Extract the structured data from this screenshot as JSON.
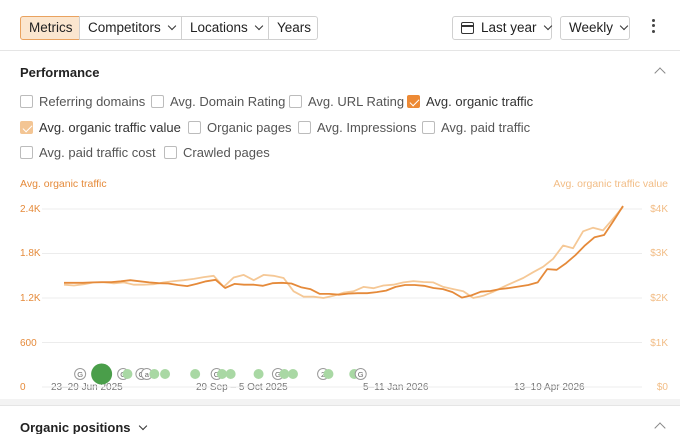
{
  "toolbar": {
    "tabs": [
      {
        "label": "Metrics",
        "active": true,
        "has_dropdown": false
      },
      {
        "label": "Competitors",
        "has_dropdown": true
      },
      {
        "label": "Locations",
        "has_dropdown": true
      },
      {
        "label": "Years",
        "has_dropdown": false
      }
    ],
    "date_range": "Last year",
    "interval": "Weekly"
  },
  "performance": {
    "title": "Performance",
    "metrics": [
      {
        "label": "Referring domains",
        "checked": false
      },
      {
        "label": "Avg. Domain Rating",
        "checked": false
      },
      {
        "label": "Avg. URL Rating",
        "checked": false
      },
      {
        "label": "Avg. organic traffic",
        "checked": true
      },
      {
        "label": "Avg. organic traffic value",
        "checked": true
      },
      {
        "label": "Organic pages",
        "checked": false
      },
      {
        "label": "Avg. Impressions",
        "checked": false
      },
      {
        "label": "Avg. paid traffic",
        "checked": false
      },
      {
        "label": "Avg. paid traffic cost",
        "checked": false
      },
      {
        "label": "Crawled pages",
        "checked": false
      }
    ]
  },
  "chart_data": {
    "type": "line",
    "left_axis_label": "Avg. organic traffic",
    "right_axis_label": "Avg. organic traffic value",
    "y_ticks_left": [
      "2.4K",
      "1.8K",
      "1.2K",
      "600",
      "0"
    ],
    "y_ticks_right": [
      "$4K",
      "$3K",
      "$2K",
      "$1K",
      "$0"
    ],
    "x_ticks": [
      "23–29 Jun 2025",
      "29 Sep – 5 Oct 2025",
      "5–11 Jan 2026",
      "13–19 Apr 2026"
    ],
    "colors": {
      "traffic": "#e58a3a",
      "value": "#f5c896",
      "marker": "#a9d8a4",
      "marker_big": "#4a9e4a"
    },
    "series": [
      {
        "name": "Avg. organic traffic",
        "axis": "left",
        "values": [
          1405,
          1405,
          1405,
          1410,
          1415,
          1415,
          1425,
          1440,
          1425,
          1410,
          1400,
          1395,
          1375,
          1360,
          1390,
          1425,
          1445,
          1335,
          1390,
          1380,
          1380,
          1365,
          1400,
          1405,
          1395,
          1345,
          1320,
          1255,
          1255,
          1245,
          1260,
          1265,
          1265,
          1280,
          1300,
          1350,
          1375,
          1375,
          1365,
          1335,
          1320,
          1280,
          1205,
          1235,
          1285,
          1295,
          1320,
          1335,
          1355,
          1375,
          1410,
          1590,
          1580,
          1670,
          1780,
          1910,
          2020,
          2050,
          2240,
          2440
        ]
      },
      {
        "name": "Avg. organic traffic value",
        "axis": "right",
        "values": [
          2.3,
          2.28,
          2.31,
          2.35,
          2.35,
          2.33,
          2.35,
          2.3,
          2.3,
          2.31,
          2.35,
          2.38,
          2.4,
          2.43,
          2.47,
          2.5,
          2.25,
          2.46,
          2.52,
          2.4,
          2.52,
          2.5,
          2.45,
          2.15,
          2.03,
          2.03,
          2.0,
          2.05,
          2.12,
          2.15,
          2.25,
          2.22,
          2.28,
          2.3,
          2.35,
          2.38,
          2.36,
          2.35,
          2.25,
          2.2,
          2.15,
          2.0,
          2.05,
          2.14,
          2.25,
          2.35,
          2.45,
          2.58,
          2.7,
          2.88,
          3.18,
          3.12,
          3.5,
          3.58,
          3.52,
          3.78,
          4.05
        ]
      }
    ],
    "annotations": [
      {
        "type": "G",
        "week": 1
      },
      {
        "type": "big",
        "week": 3
      },
      {
        "type": "G",
        "week": 5
      },
      {
        "type": "dot",
        "week": 5.4
      },
      {
        "type": "G",
        "week": 6.7
      },
      {
        "type": "a",
        "week": 7.2
      },
      {
        "type": "dot",
        "week": 7.9
      },
      {
        "type": "dot",
        "week": 8.9
      },
      {
        "type": "dot",
        "week": 11.7
      },
      {
        "type": "G",
        "week": 13.7
      },
      {
        "type": "dot",
        "week": 14.2
      },
      {
        "type": "dot",
        "week": 15.0
      },
      {
        "type": "dot",
        "week": 17.6
      },
      {
        "type": "G",
        "week": 19.4
      },
      {
        "type": "dot",
        "week": 20.0
      },
      {
        "type": "dot",
        "week": 20.8
      },
      {
        "type": "2",
        "week": 23.6
      },
      {
        "type": "dot",
        "week": 24.1
      },
      {
        "type": "dot",
        "week": 26.5
      },
      {
        "type": "G",
        "week": 27.1
      }
    ]
  },
  "organic_positions": {
    "title": "Organic positions"
  }
}
